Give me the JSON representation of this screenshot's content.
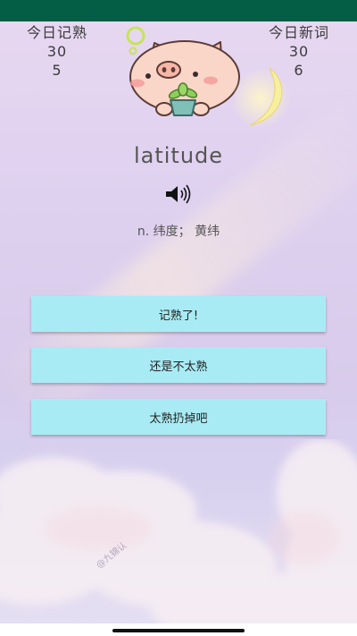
{
  "status_bar": {
    "color": "#045d45"
  },
  "counters": {
    "left": {
      "title": "今日记熟",
      "target": "30",
      "count": "5"
    },
    "right": {
      "title": "今日新词",
      "target": "30",
      "count": "6"
    }
  },
  "card": {
    "word": "latitude",
    "meaning": "n. 纬度； 黄纬",
    "speaker_icon": "speaker-icon"
  },
  "buttons": {
    "remembered": "记熟了!",
    "not_quite": "还是不太熟",
    "discard": "太熟扔掉吧"
  },
  "decor": {
    "mascot": "pig-mascot",
    "moon": "crescent-moon",
    "watermark": "@九锦认"
  },
  "colors": {
    "button": "#a9ebf4",
    "background_top": "#e8d8f1",
    "background_bottom": "#e6e0f3"
  }
}
